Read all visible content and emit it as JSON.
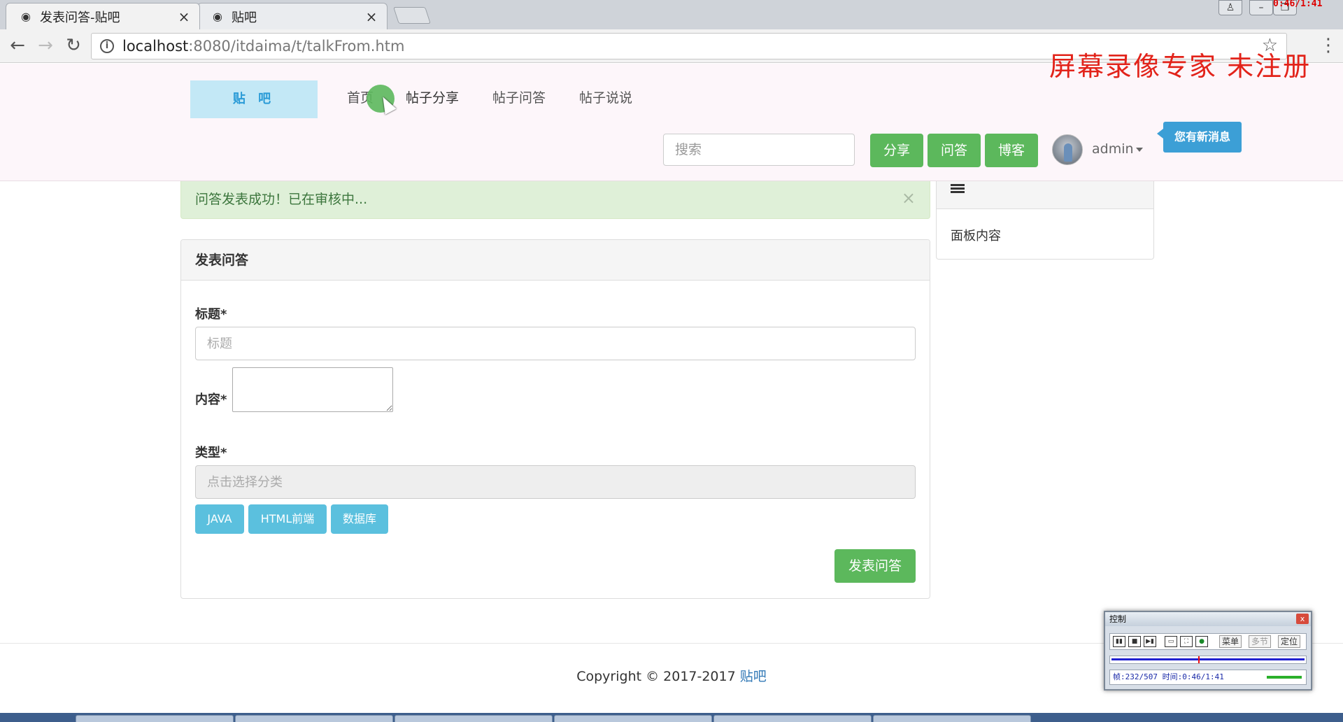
{
  "browser": {
    "tabs": [
      {
        "title": "发表问答-贴吧",
        "active": true
      },
      {
        "title": "贴吧",
        "active": false
      }
    ],
    "url_host": "localhost",
    "url_rest": ":8080/itdaima/t/talkFrom.htm",
    "recorder_time": "0:46/1:41"
  },
  "watermark": "屏幕录像专家 未注册",
  "site": {
    "logo": "贴 吧",
    "nav": [
      "首页",
      "帖子分享",
      "帖子问答",
      "帖子说说"
    ],
    "search_placeholder": "搜索",
    "action_buttons": [
      "分享",
      "问答",
      "博客"
    ],
    "user_name": "admin",
    "new_message": "您有新消息"
  },
  "alert": {
    "text": "问答发表成功！已在审核中...",
    "close": "×"
  },
  "form": {
    "heading": "发表问答",
    "title_label": "标题*",
    "title_placeholder": "标题",
    "content_label": "内容*",
    "type_label": "类型*",
    "type_placeholder": "点击选择分类",
    "categories": [
      "JAVA",
      "HTML前端",
      "数据库"
    ],
    "submit_label": "发表问答"
  },
  "side_panel": {
    "body": "面板内容"
  },
  "footer": {
    "copyright": "Copyright © 2017-2017",
    "link": "贴吧"
  },
  "recorder": {
    "title": "控制",
    "menu_label": "菜单",
    "multi_label": "多节",
    "locate_label": "定位",
    "status": "帧:232/507 时间:0:46/1:41"
  },
  "colors": {
    "primary_green": "#5cb85c",
    "info_blue": "#5bc0de",
    "alert_bg": "#dff0d8",
    "watermark_red": "#e2231a"
  }
}
